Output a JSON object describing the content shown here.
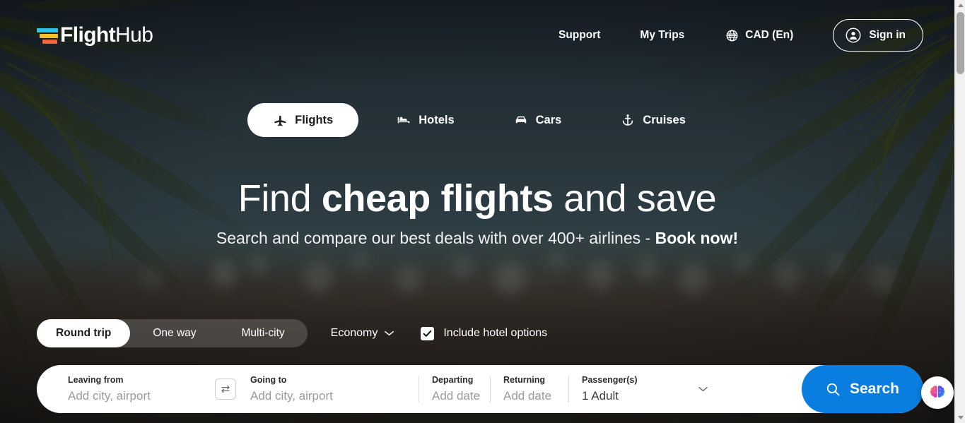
{
  "brand": {
    "name_bold": "Flight",
    "name_light": "Hub",
    "logo_colors": [
      "#2ec3e8",
      "#f2c029",
      "#ef6535"
    ]
  },
  "header": {
    "support_label": "Support",
    "my_trips_label": "My Trips",
    "language_label": "CAD (En)",
    "language_icon": "globe-icon",
    "signin_label": "Sign in",
    "signin_icon": "user-circle-icon"
  },
  "tabs": [
    {
      "label": "Flights",
      "icon": "plane-icon",
      "active": true
    },
    {
      "label": "Hotels",
      "icon": "bed-icon",
      "active": false
    },
    {
      "label": "Cars",
      "icon": "car-icon",
      "active": false
    },
    {
      "label": "Cruises",
      "icon": "anchor-icon",
      "active": false
    }
  ],
  "hero": {
    "headline_pre": "Find ",
    "headline_em": "cheap flights",
    "headline_post": " and save",
    "subhead_pre": "Search and compare our best deals with over 400+ airlines - ",
    "subhead_em": "Book now!"
  },
  "options": {
    "trip_types": [
      {
        "label": "Round trip",
        "active": true
      },
      {
        "label": "One way",
        "active": false
      },
      {
        "label": "Multi-city",
        "active": false
      }
    ],
    "cabin_class": "Economy",
    "cabin_icon": "chevron-down-icon",
    "hotel_checkbox_label": "Include hotel options",
    "hotel_checkbox_checked": true,
    "checkbox_icon": "check-icon"
  },
  "search_form": {
    "from": {
      "label": "Leaving from",
      "placeholder": "Add city, airport",
      "value": ""
    },
    "swap_icon": "swap-arrows-icon",
    "to": {
      "label": "Going to",
      "placeholder": "Add city, airport",
      "value": ""
    },
    "departing": {
      "label": "Departing",
      "placeholder": "Add date",
      "value": ""
    },
    "returning": {
      "label": "Returning",
      "placeholder": "Add date",
      "value": ""
    },
    "passengers": {
      "label": "Passenger(s)",
      "value": "1 Adult",
      "icon": "chevron-down-icon"
    },
    "search_button": {
      "label": "Search",
      "icon": "search-icon",
      "color": "#0a7ee0"
    }
  },
  "ai_widget": {
    "icon": "brain-ai-icon"
  },
  "scrollbar": {
    "up_icon": "caret-up-icon",
    "down_icon": "caret-down-icon"
  }
}
